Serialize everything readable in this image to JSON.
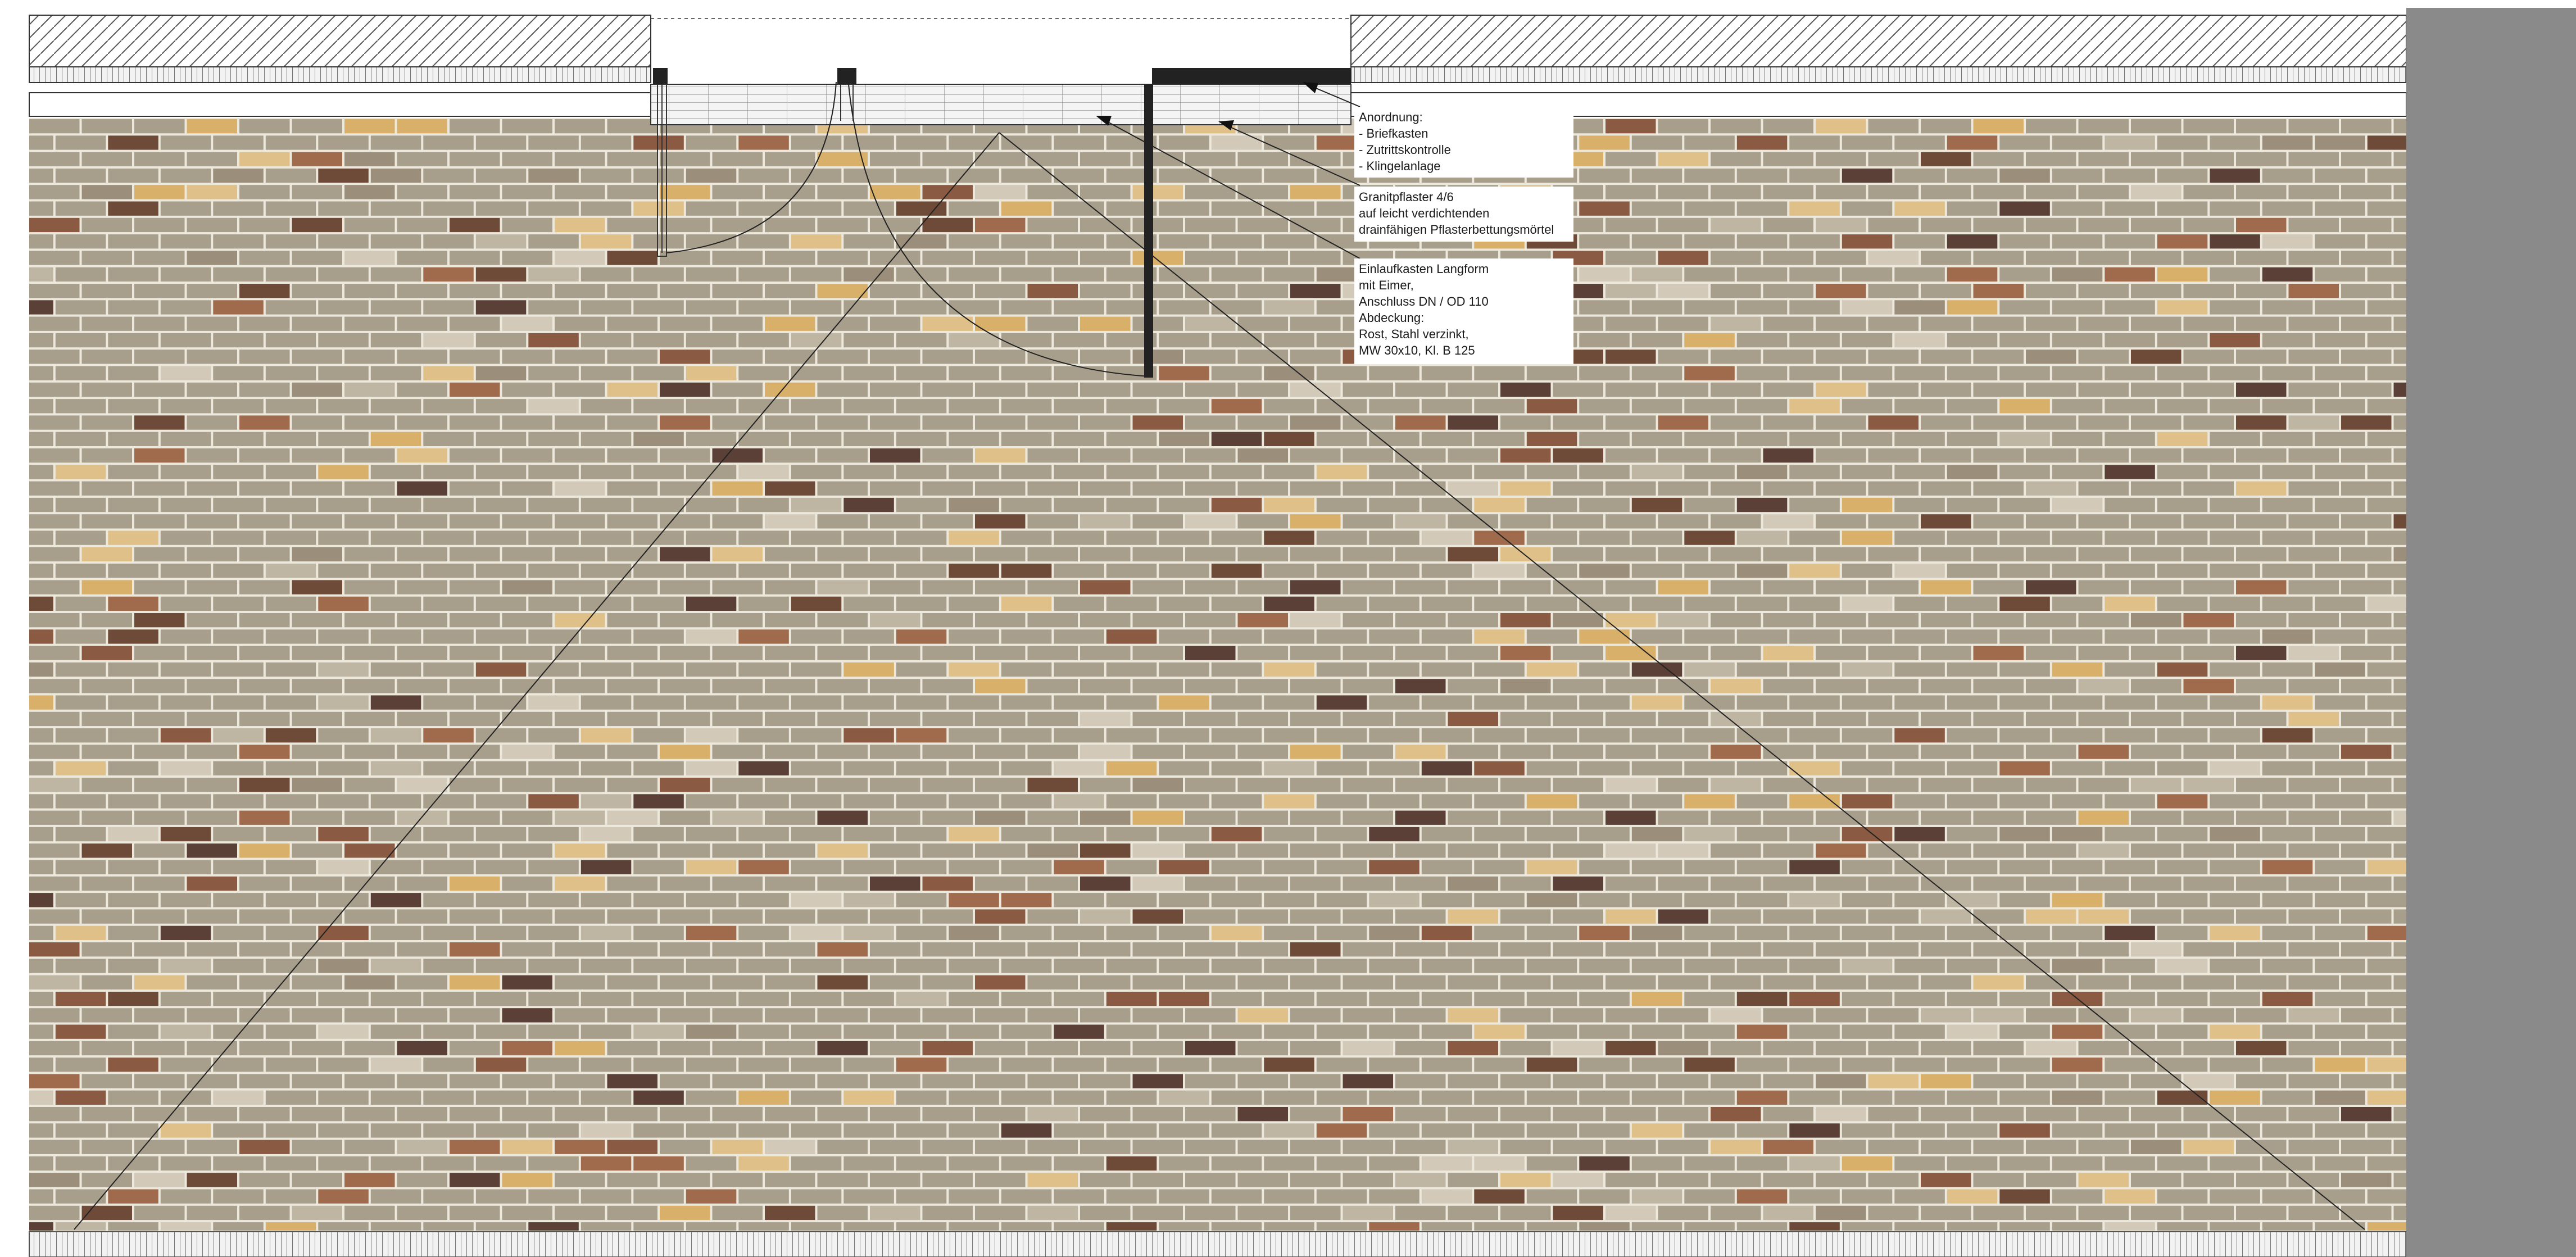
{
  "notes": {
    "anordnung": [
      "Anordnung:",
      "- Briefkasten",
      "- Zutrittskontrolle",
      "- Klingelanlage"
    ],
    "pflaster": [
      "Granitpflaster 4/6",
      "auf leicht verdichtenden",
      "drainfähigen Pflasterbettungsmörtel"
    ],
    "einlauf": [
      "Einlaufkasten Langform",
      "mit Eimer,",
      "Anschluss DN / OD 110",
      "Abdeckung:",
      "Rost, Stahl verzinkt,",
      "MW 30x10, Kl. B 125"
    ]
  },
  "colors": {
    "mortar": "#ece8dc",
    "brick_base": "#a89e8c",
    "brick_variants": [
      "#bfb5a3",
      "#d2c9b8",
      "#9b8f7c",
      "#6e4a38",
      "#8a5a42",
      "#a06a4c",
      "#d9b06a",
      "#e0c089",
      "#5a4036"
    ],
    "side_panel": "#8a8a8a",
    "line": "#1a1a1a"
  }
}
